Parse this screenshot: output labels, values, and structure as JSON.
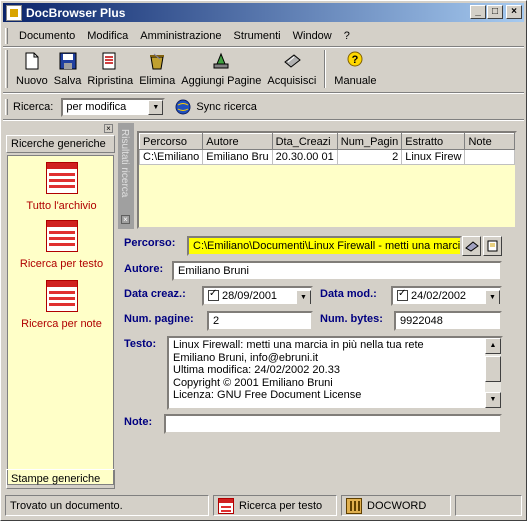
{
  "window": {
    "title": "DocBrowser Plus",
    "min": "_",
    "max": "□",
    "close": "×"
  },
  "menu": {
    "items": [
      "Documento",
      "Modifica",
      "Amministrazione",
      "Strumenti",
      "Window",
      "?"
    ]
  },
  "toolbar": {
    "nuovo": "Nuovo",
    "salva": "Salva",
    "ripristina": "Ripristina",
    "elimina": "Elimina",
    "aggiungi": "Aggiungi Pagine",
    "acquisisci": "Acquisisci",
    "manuale": "Manuale"
  },
  "search": {
    "label": "Ricerca:",
    "value": "per modifica",
    "sync": "Sync ricerca"
  },
  "leftpanel": {
    "close": "×",
    "header": "Ricerche generiche",
    "items": [
      "Tutto l'archivio",
      "Ricerca per testo",
      "Ricerca per note"
    ],
    "footer": "Stampe generiche"
  },
  "results": {
    "side_label": "Risultati ricerca",
    "columns": [
      "Percorso",
      "Autore",
      "Dta_Creazi",
      "Num_Pagin",
      "Estratto",
      "Note"
    ],
    "rows": [
      [
        "C:\\Emiliano",
        "Emiliano Bru",
        "01 20.30.00",
        "2",
        "Linux Firew",
        ""
      ]
    ]
  },
  "form": {
    "percorso_label": "Percorso:",
    "percorso_value": "C:\\Emiliano\\Documenti\\Linux Firewall - metti una marcia in più",
    "autore_label": "Autore:",
    "autore_value": "Emiliano Bruni",
    "data_creaz_label": "Data creaz.:",
    "data_creaz_value": "28/09/2001",
    "data_mod_label": "Data mod.:",
    "data_mod_value": "24/02/2002",
    "num_pagine_label": "Num. pagine:",
    "num_pagine_value": "2",
    "num_bytes_label": "Num. bytes:",
    "num_bytes_value": "9922048",
    "testo_label": "Testo:",
    "testo_lines": [
      "Linux Firewall: metti una marcia in più nella tua rete",
      "Emiliano Bruni, info@ebruni.it",
      "Ultima modifica: 24/02/2002 20.33",
      "Copyright © 2001 Emiliano Bruni",
      "Licenza: GNU Free Document License"
    ],
    "note_label": "Note:",
    "note_value": ""
  },
  "status": {
    "message": "Trovato un documento.",
    "mode": "Ricerca per testo",
    "doctype": "DOCWORD"
  },
  "colors": {
    "accent_title": "#0a246a",
    "label": "#000080",
    "pane": "#ffffc8",
    "highlight": "#ffff00",
    "icon_red": "#b00000"
  }
}
